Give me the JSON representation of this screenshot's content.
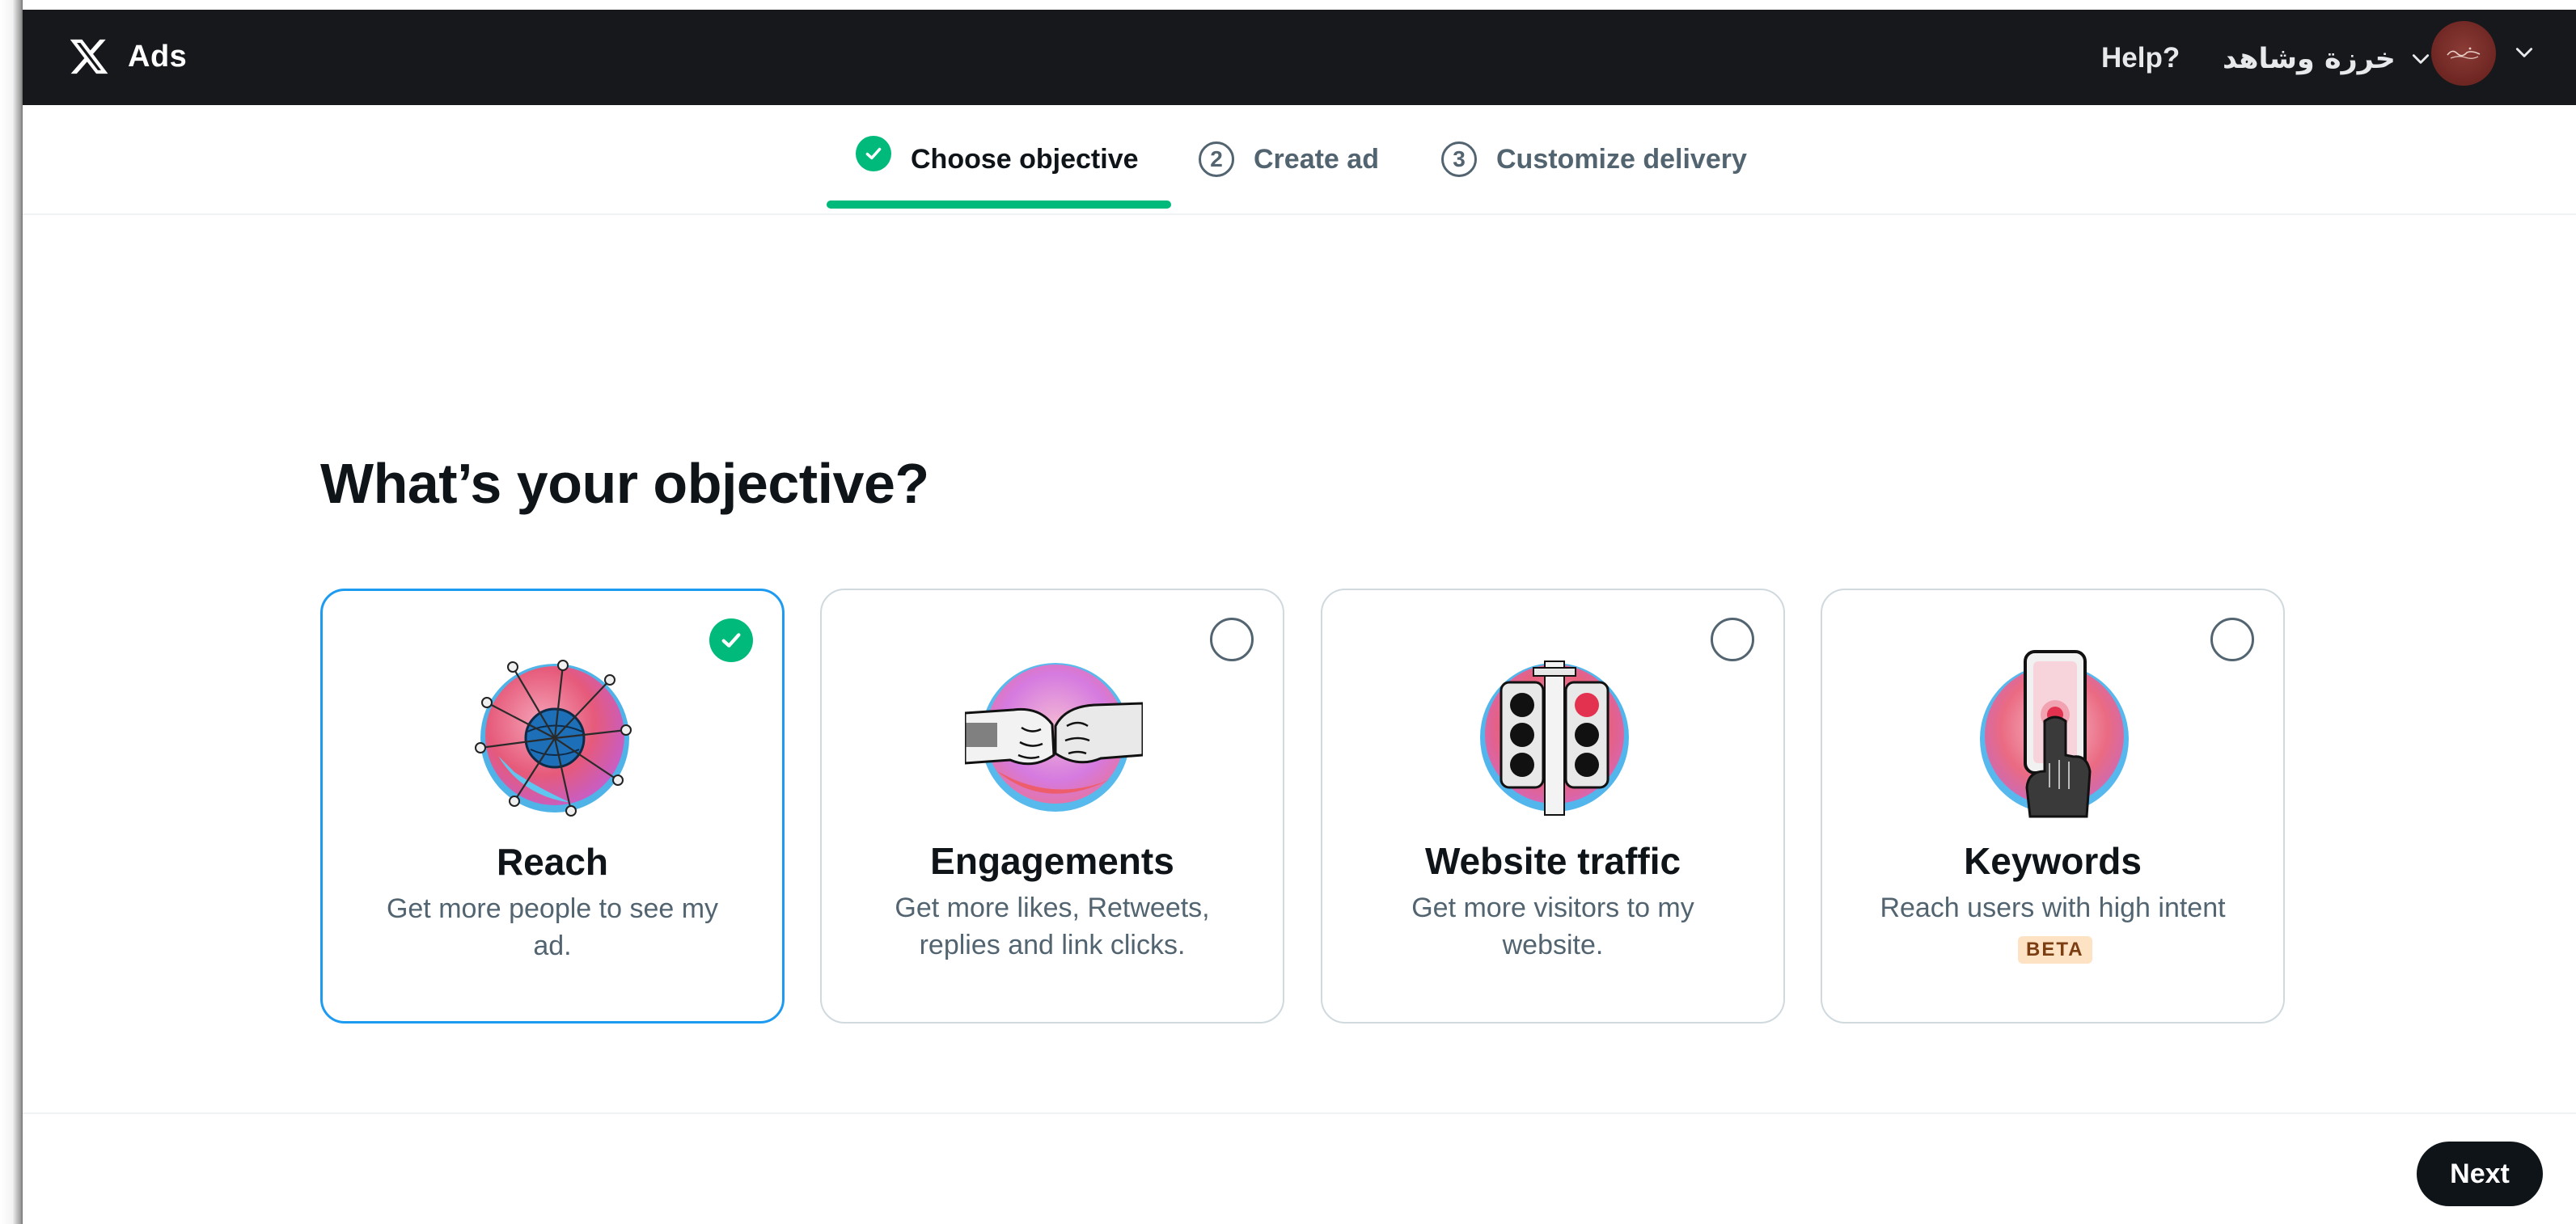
{
  "header": {
    "brand": "Ads",
    "help_label": "Help?",
    "account_name": "خرزة وشاهد"
  },
  "stepper": {
    "steps": [
      {
        "number": "1",
        "label": "Choose objective",
        "status": "complete"
      },
      {
        "number": "2",
        "label": "Create ad",
        "status": "pending"
      },
      {
        "number": "3",
        "label": "Customize delivery",
        "status": "pending"
      }
    ]
  },
  "main": {
    "heading": "What’s your objective?",
    "cards": [
      {
        "title": "Reach",
        "description": "Get more people to see my ad.",
        "selected": true,
        "icon": "globe-network-illustration"
      },
      {
        "title": "Engagements",
        "description": "Get more likes, Retweets, replies and link clicks.",
        "selected": false,
        "icon": "fist-bump-illustration"
      },
      {
        "title": "Website traffic",
        "description": "Get more visitors to my website.",
        "selected": false,
        "icon": "traffic-light-illustration"
      },
      {
        "title": "Keywords",
        "description": "Reach users with high intent",
        "selected": false,
        "badge": "BETA",
        "icon": "phone-tap-illustration"
      }
    ]
  },
  "footer": {
    "next_label": "Next"
  },
  "colors": {
    "topbar": "#16181c",
    "accent_green": "#00ba7c",
    "selected_border": "#1d9bf0",
    "text_primary": "#0f1419",
    "text_secondary": "#536471"
  }
}
